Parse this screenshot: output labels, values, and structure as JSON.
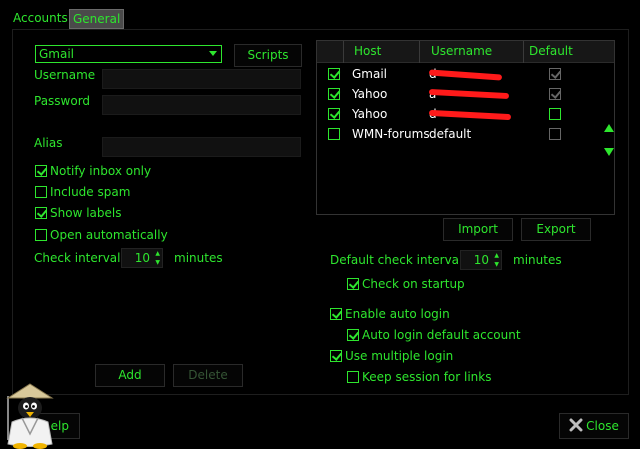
{
  "tabs": [
    {
      "label": "Accounts",
      "active": false
    },
    {
      "label": "General",
      "active": true
    }
  ],
  "account": {
    "provider": "Gmail",
    "scripts_label": "Scripts",
    "username_label": "Username",
    "password_label": "Password",
    "alias_label": "Alias",
    "username_value": "",
    "password_value": "",
    "alias_value": "",
    "options": [
      {
        "label": "Notify inbox only",
        "checked": true
      },
      {
        "label": "Include spam",
        "checked": false
      },
      {
        "label": "Show labels",
        "checked": true
      },
      {
        "label": "Open automatically",
        "checked": false
      }
    ],
    "check_interval_label": "Check interval",
    "check_interval_value": "10",
    "minutes_label": "minutes",
    "add_label": "Add",
    "delete_label": "Delete"
  },
  "accounts_table": {
    "headers": [
      "Host",
      "Username",
      "Default"
    ],
    "rows": [
      {
        "checked": true,
        "host": "Gmail",
        "username": "d",
        "default": true
      },
      {
        "checked": true,
        "host": "Yahoo",
        "username": "a",
        "default": true
      },
      {
        "checked": true,
        "host": "Yahoo",
        "username": "d",
        "default": false
      },
      {
        "checked": false,
        "host": "WMN-forums",
        "username": "default",
        "default": false
      }
    ]
  },
  "import_label": "Import",
  "export_label": "Export",
  "general": {
    "default_check_interval_label": "Default check interval",
    "default_check_interval_value": "10",
    "minutes_label": "minutes",
    "check_on_startup": {
      "label": "Check on startup",
      "checked": true
    },
    "enable_auto_login": {
      "label": "Enable auto login",
      "checked": true
    },
    "auto_login_default": {
      "label": "Auto login default account",
      "checked": true
    },
    "use_multiple_login": {
      "label": "Use multiple login",
      "checked": true
    },
    "keep_session": {
      "label": "Keep session for links",
      "checked": false
    }
  },
  "help_label": "elp",
  "close_label": "Close",
  "colors": {
    "accent": "#2ee62e",
    "background": "#000000",
    "redaction": "#ff1a1a"
  }
}
